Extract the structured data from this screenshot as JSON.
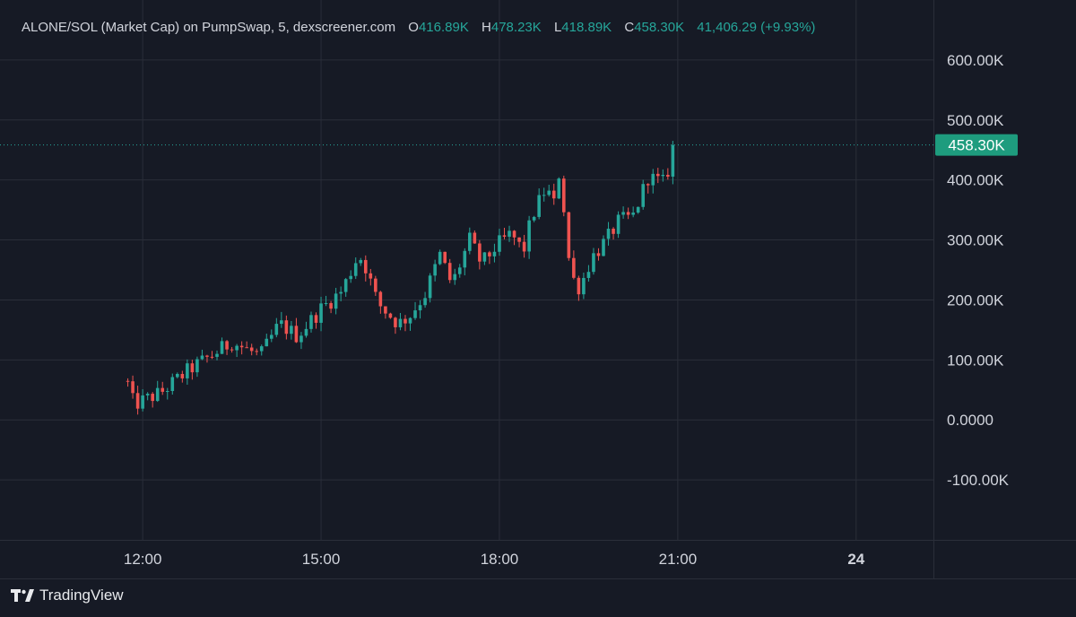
{
  "header": {
    "symbol": "ALONE/SOL (Market Cap) on PumpSwap, 5, dexscreener.com",
    "open_label": "O",
    "open": "416.89K",
    "high_label": "H",
    "high": "478.23K",
    "low_label": "L",
    "low": "418.89K",
    "close_label": "C",
    "close": "458.30K",
    "change": "41,406.29 (+9.93%)"
  },
  "branding": {
    "name": "TradingView"
  },
  "colors": {
    "background": "#161a25",
    "grid": "#2a2e39",
    "up": "#26a69a",
    "down": "#ef5350",
    "text": "#d1d4dc",
    "price_label_bg": "#1e9c7e"
  },
  "last_price_label": "458.30K",
  "chart_data": {
    "type": "candlestick",
    "title": "ALONE/SOL (Market Cap) on PumpSwap, 5, dexscreener.com",
    "ylim": [
      -200,
      700
    ],
    "y_ticks": [
      -100,
      0,
      100,
      200,
      300,
      400,
      500,
      600
    ],
    "y_tick_labels": [
      "-100.00K",
      "0.0000",
      "100.00K",
      "200.00K",
      "300.00K",
      "400.00K",
      "500.00K",
      "600.00K"
    ],
    "x_ticks": [
      12,
      15,
      18,
      21,
      24
    ],
    "x_tick_labels": [
      "12:00",
      "15:00",
      "18:00",
      "21:00",
      "24"
    ],
    "xlim": [
      9.6,
      25.3
    ],
    "last_price": 458.3,
    "grid": true,
    "ohlc_keypoints_hours_vs_thousands": [
      [
        11.75,
        60
      ],
      [
        11.85,
        25
      ],
      [
        12.3,
        45
      ],
      [
        12.8,
        85
      ],
      [
        13.2,
        110
      ],
      [
        13.5,
        130
      ],
      [
        13.9,
        110
      ],
      [
        14.0,
        110
      ],
      [
        14.3,
        160
      ],
      [
        14.6,
        140
      ],
      [
        15.0,
        185
      ],
      [
        15.35,
        215
      ],
      [
        15.6,
        270
      ],
      [
        15.7,
        270
      ],
      [
        15.95,
        195
      ],
      [
        16.3,
        160
      ],
      [
        16.5,
        175
      ],
      [
        16.75,
        210
      ],
      [
        17.0,
        275
      ],
      [
        17.2,
        225
      ],
      [
        17.5,
        300
      ],
      [
        17.7,
        260
      ],
      [
        17.95,
        290
      ],
      [
        18.2,
        310
      ],
      [
        18.4,
        280
      ],
      [
        18.55,
        340
      ],
      [
        18.8,
        390
      ],
      [
        18.9,
        350
      ],
      [
        19.0,
        410
      ],
      [
        19.05,
        400
      ],
      [
        19.1,
        330
      ],
      [
        19.2,
        240
      ],
      [
        19.35,
        220
      ],
      [
        19.55,
        270
      ],
      [
        19.8,
        300
      ],
      [
        20.0,
        330
      ],
      [
        20.25,
        340
      ],
      [
        20.5,
        405
      ],
      [
        20.75,
        395
      ],
      [
        20.85,
        420
      ],
      [
        20.95,
        458.3
      ]
    ]
  }
}
